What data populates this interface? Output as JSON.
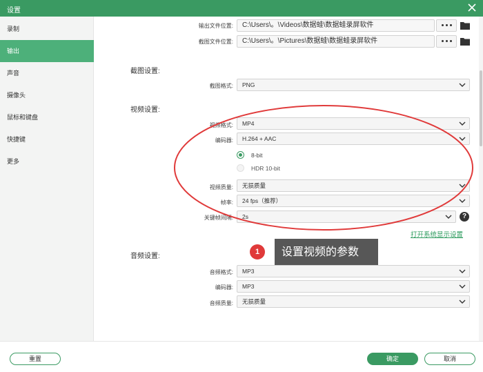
{
  "window": {
    "title": "设置"
  },
  "sidebar": {
    "items": [
      {
        "label": "录制",
        "active": false
      },
      {
        "label": "输出",
        "active": true
      },
      {
        "label": "声音",
        "active": false
      },
      {
        "label": "摄像头",
        "active": false
      },
      {
        "label": "鼠标和键盘",
        "active": false
      },
      {
        "label": "快捷键",
        "active": false
      },
      {
        "label": "更多",
        "active": false
      }
    ]
  },
  "output": {
    "file_location_label": "输出文件位置:",
    "file_location_value": "C:\\Users\\。\\Videos\\数据蛙\\数据蛙录屏软件",
    "screenshot_location_label": "截图文件位置:",
    "screenshot_location_value": "C:\\Users\\。\\Pictures\\数据蛙\\数据蛙录屏软件"
  },
  "screenshot_settings": {
    "title": "截图设置:",
    "format_label": "截图格式:",
    "format_value": "PNG"
  },
  "video_settings": {
    "title": "视频设置:",
    "format_label": "视频格式:",
    "format_value": "MP4",
    "encoder_label": "编码器:",
    "encoder_value": "H.264 + AAC",
    "bit_8_label": "8-bit",
    "bit_8_selected": true,
    "hdr_label": "HDR 10-bit",
    "hdr_enabled": false,
    "quality_label": "视频质量:",
    "quality_value": "无损质量",
    "framerate_label": "帧率:",
    "framerate_value": "24 fps（推荐）",
    "keyframe_label": "关键帧间隔:",
    "keyframe_value": "2s",
    "help_symbol": "?",
    "display_settings_link": "打开系统显示设置"
  },
  "audio_settings": {
    "title": "音频设置:",
    "format_label": "音频格式:",
    "format_value": "MP3",
    "encoder_label": "编码器:",
    "encoder_value": "MP3",
    "quality_label": "音频质量:",
    "quality_value": "无损质量"
  },
  "callout": {
    "number": "1",
    "text": "设置视频的参数"
  },
  "footer": {
    "reset_label": "重置",
    "ok_label": "确定",
    "cancel_label": "取消"
  },
  "colors": {
    "accent": "#3a9a62",
    "sidebar_active": "#4db07a",
    "annotation_red": "#e03a3a",
    "callout_bg": "#575757"
  },
  "icons": {
    "close": "close-icon",
    "folder": "folder-icon",
    "chevron": "chevron-down-icon",
    "more": "more-dots-icon",
    "help": "help-icon"
  }
}
